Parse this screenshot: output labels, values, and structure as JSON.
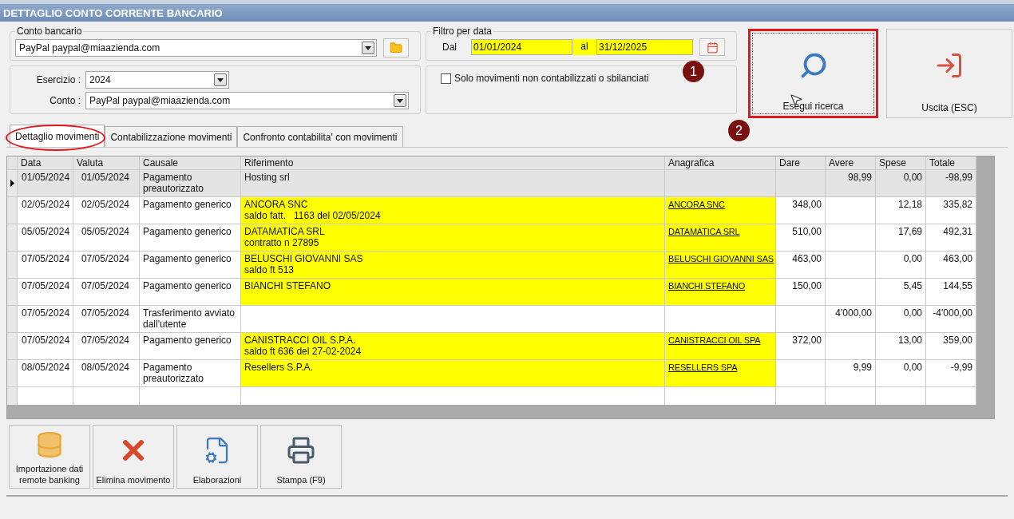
{
  "window": {
    "title": "DETTAGLIO CONTO CORRENTE BANCARIO"
  },
  "conto_bancario": {
    "legend": "Conto bancario",
    "value": "PayPal paypal@miaazienda.com"
  },
  "esercizio": {
    "label": "Esercizio :",
    "value": "2024"
  },
  "conto": {
    "label": "Conto :",
    "value": "PayPal paypal@miaazienda.com"
  },
  "filtro": {
    "legend": "Filtro per data",
    "from_label": "Dal",
    "from": "01/01/2024",
    "to_label": "al",
    "to": "31/12/2025"
  },
  "solo_movimenti": {
    "label": "Solo movimenti non contabilizzati o sbilanciati",
    "checked": false
  },
  "actions": [
    {
      "label": "Esegui ricerca",
      "kind": "search",
      "focused": true
    },
    {
      "label": "Uscita (ESC)",
      "kind": "exit",
      "focused": false
    }
  ],
  "tabs": [
    {
      "label": "Dettaglio movimenti",
      "selected": true
    },
    {
      "label": "Contabilizzazione movimenti",
      "selected": false
    },
    {
      "label": "Confronto contabilita' con movimenti",
      "selected": false
    }
  ],
  "table": {
    "columns": [
      "Data",
      "Valuta",
      "Causale",
      "Riferimento",
      "Anagrafica",
      "Dare",
      "Avere",
      "Spese",
      "Totale"
    ],
    "rows": [
      {
        "data": "01/05/2024",
        "valuta": "01/05/2024",
        "causale": "Pagamento preautorizzato",
        "riferimento": "Hosting srl",
        "anagrafica": "",
        "dare": "",
        "avere": "98,99",
        "spese": "0,00",
        "totale": "-98,99",
        "selected": true,
        "highlighted": false
      },
      {
        "data": "02/05/2024",
        "valuta": "02/05/2024",
        "causale": "Pagamento generico",
        "riferimento": "ANCORA SNC\nsaldo fatt.   1163 del 02/05/2024",
        "anagrafica": "ANCORA SNC",
        "dare": "348,00",
        "avere": "",
        "spese": "12,18",
        "totale": "335,82",
        "selected": false,
        "highlighted": true
      },
      {
        "data": "05/05/2024",
        "valuta": "05/05/2024",
        "causale": "Pagamento generico",
        "riferimento": "DATAMATICA SRL\ncontratto n 27895",
        "anagrafica": "DATAMATICA SRL",
        "dare": "510,00",
        "avere": "",
        "spese": "17,69",
        "totale": "492,31",
        "selected": false,
        "highlighted": true
      },
      {
        "data": "07/05/2024",
        "valuta": "07/05/2024",
        "causale": "Pagamento generico",
        "riferimento": "BELUSCHI GIOVANNI SAS\nsaldo ft 513",
        "anagrafica": "BELUSCHI GIOVANNI SAS",
        "dare": "463,00",
        "avere": "",
        "spese": "0,00",
        "totale": "463,00",
        "selected": false,
        "highlighted": true
      },
      {
        "data": "07/05/2024",
        "valuta": "07/05/2024",
        "causale": "Pagamento generico",
        "riferimento": "BIANCHI STEFANO",
        "anagrafica": "BIANCHI STEFANO",
        "dare": "150,00",
        "avere": "",
        "spese": "5,45",
        "totale": "144,55",
        "selected": false,
        "highlighted": true
      },
      {
        "data": "07/05/2024",
        "valuta": "07/05/2024",
        "causale": "Trasferimento avviato dall'utente",
        "riferimento": "",
        "anagrafica": "",
        "dare": "",
        "avere": "4'000,00",
        "spese": "0,00",
        "totale": "-4'000,00",
        "selected": false,
        "highlighted": false
      },
      {
        "data": "07/05/2024",
        "valuta": "07/05/2024",
        "causale": "Pagamento generico",
        "riferimento": "CANISTRACCI OIL S.P.A.\nsaldo ft 636 del 27-02-2024",
        "anagrafica": "CANISTRACCI OIL SPA",
        "dare": "372,00",
        "avere": "",
        "spese": "13,00",
        "totale": "359,00",
        "selected": false,
        "highlighted": true
      },
      {
        "data": "08/05/2024",
        "valuta": "08/05/2024",
        "causale": "Pagamento preautorizzato",
        "riferimento": "Resellers S.P.A.",
        "anagrafica": "RESELLERS SPA",
        "dare": "",
        "avere": "9,99",
        "spese": "0,00",
        "totale": "-9,99",
        "selected": false,
        "highlighted": true
      }
    ]
  },
  "tools": [
    {
      "label": "Importazione dati remote banking",
      "kind": "import"
    },
    {
      "label": "Elimina movimento",
      "kind": "delete"
    },
    {
      "label": "Elaborazioni",
      "kind": "process"
    },
    {
      "label": "Stampa (F9)",
      "kind": "print"
    }
  ],
  "callouts": [
    "1",
    "2"
  ]
}
